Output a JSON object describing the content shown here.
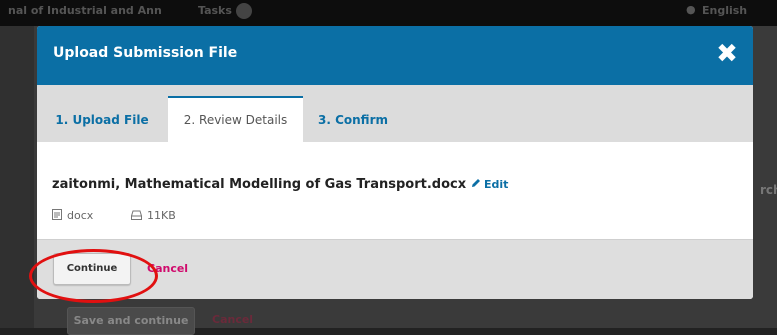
{
  "background": {
    "journal_title": "nal of Industrial and Ann",
    "tasks_label": "Tasks",
    "user_label": "English",
    "right_partial_text": "rch",
    "save_continue_label": "Save and continue",
    "cancel_label": "Cancel"
  },
  "modal": {
    "title": "Upload Submission File",
    "close_icon": "✖",
    "tabs": [
      {
        "label": "1. Upload File"
      },
      {
        "label": "2. Review Details"
      },
      {
        "label": "3. Confirm"
      }
    ],
    "file": {
      "name": "zaitonmi, Mathematical Modelling of Gas Transport.docx",
      "edit_label": "Edit",
      "type": "docx",
      "size": "11KB"
    },
    "footer": {
      "continue_label": "Continue",
      "cancel_label": "Cancel"
    }
  },
  "colors": {
    "header_blue": "#0b6fa5",
    "cancel_pink": "#d00a6c",
    "annotation_red": "#e11010"
  }
}
